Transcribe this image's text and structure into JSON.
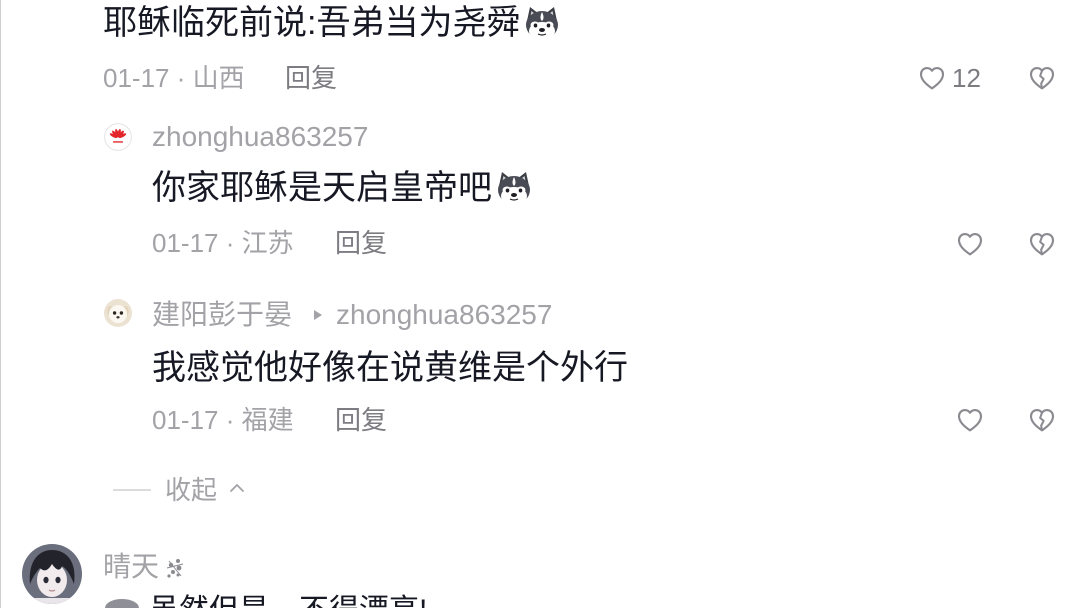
{
  "thread": {
    "comment": {
      "text": "耶稣临死前说:吾弟当为尧舜",
      "emoji": "husky-emoji",
      "meta": "01-17 · 山西",
      "reply_label": "回复",
      "like_count": "12"
    },
    "replies": [
      {
        "avatar": "huawei-logo-avatar",
        "username": "zhonghua863257",
        "text": "你家耶稣是天启皇帝吧",
        "emoji": "husky-emoji",
        "meta": "01-17 · 江苏",
        "reply_label": "回复"
      },
      {
        "avatar": "puppy-avatar",
        "username": "建阳彭于晏",
        "reply_to": "zhonghua863257",
        "text": "我感觉他好像在说黄维是个外行",
        "meta": "01-17 · 福建",
        "reply_label": "回复"
      }
    ],
    "collapse_label": "收起"
  },
  "next_comment": {
    "avatar": "anime-avatar",
    "username": "晴天",
    "badge_icon": "sparkle-icon",
    "text": "虽然但是，不得漂亮!"
  },
  "icons": {
    "like": "heart-outline-icon",
    "dislike": "broken-heart-icon",
    "reply_arrow": "triangle-right-icon",
    "collapse": "chevron-up-icon"
  },
  "colors": {
    "background": "#ffffff",
    "primary_text": "#161823",
    "secondary_text": "#a2a2a7",
    "icon_gray": "#8a8a90",
    "huawei_red": "#e3262b"
  }
}
